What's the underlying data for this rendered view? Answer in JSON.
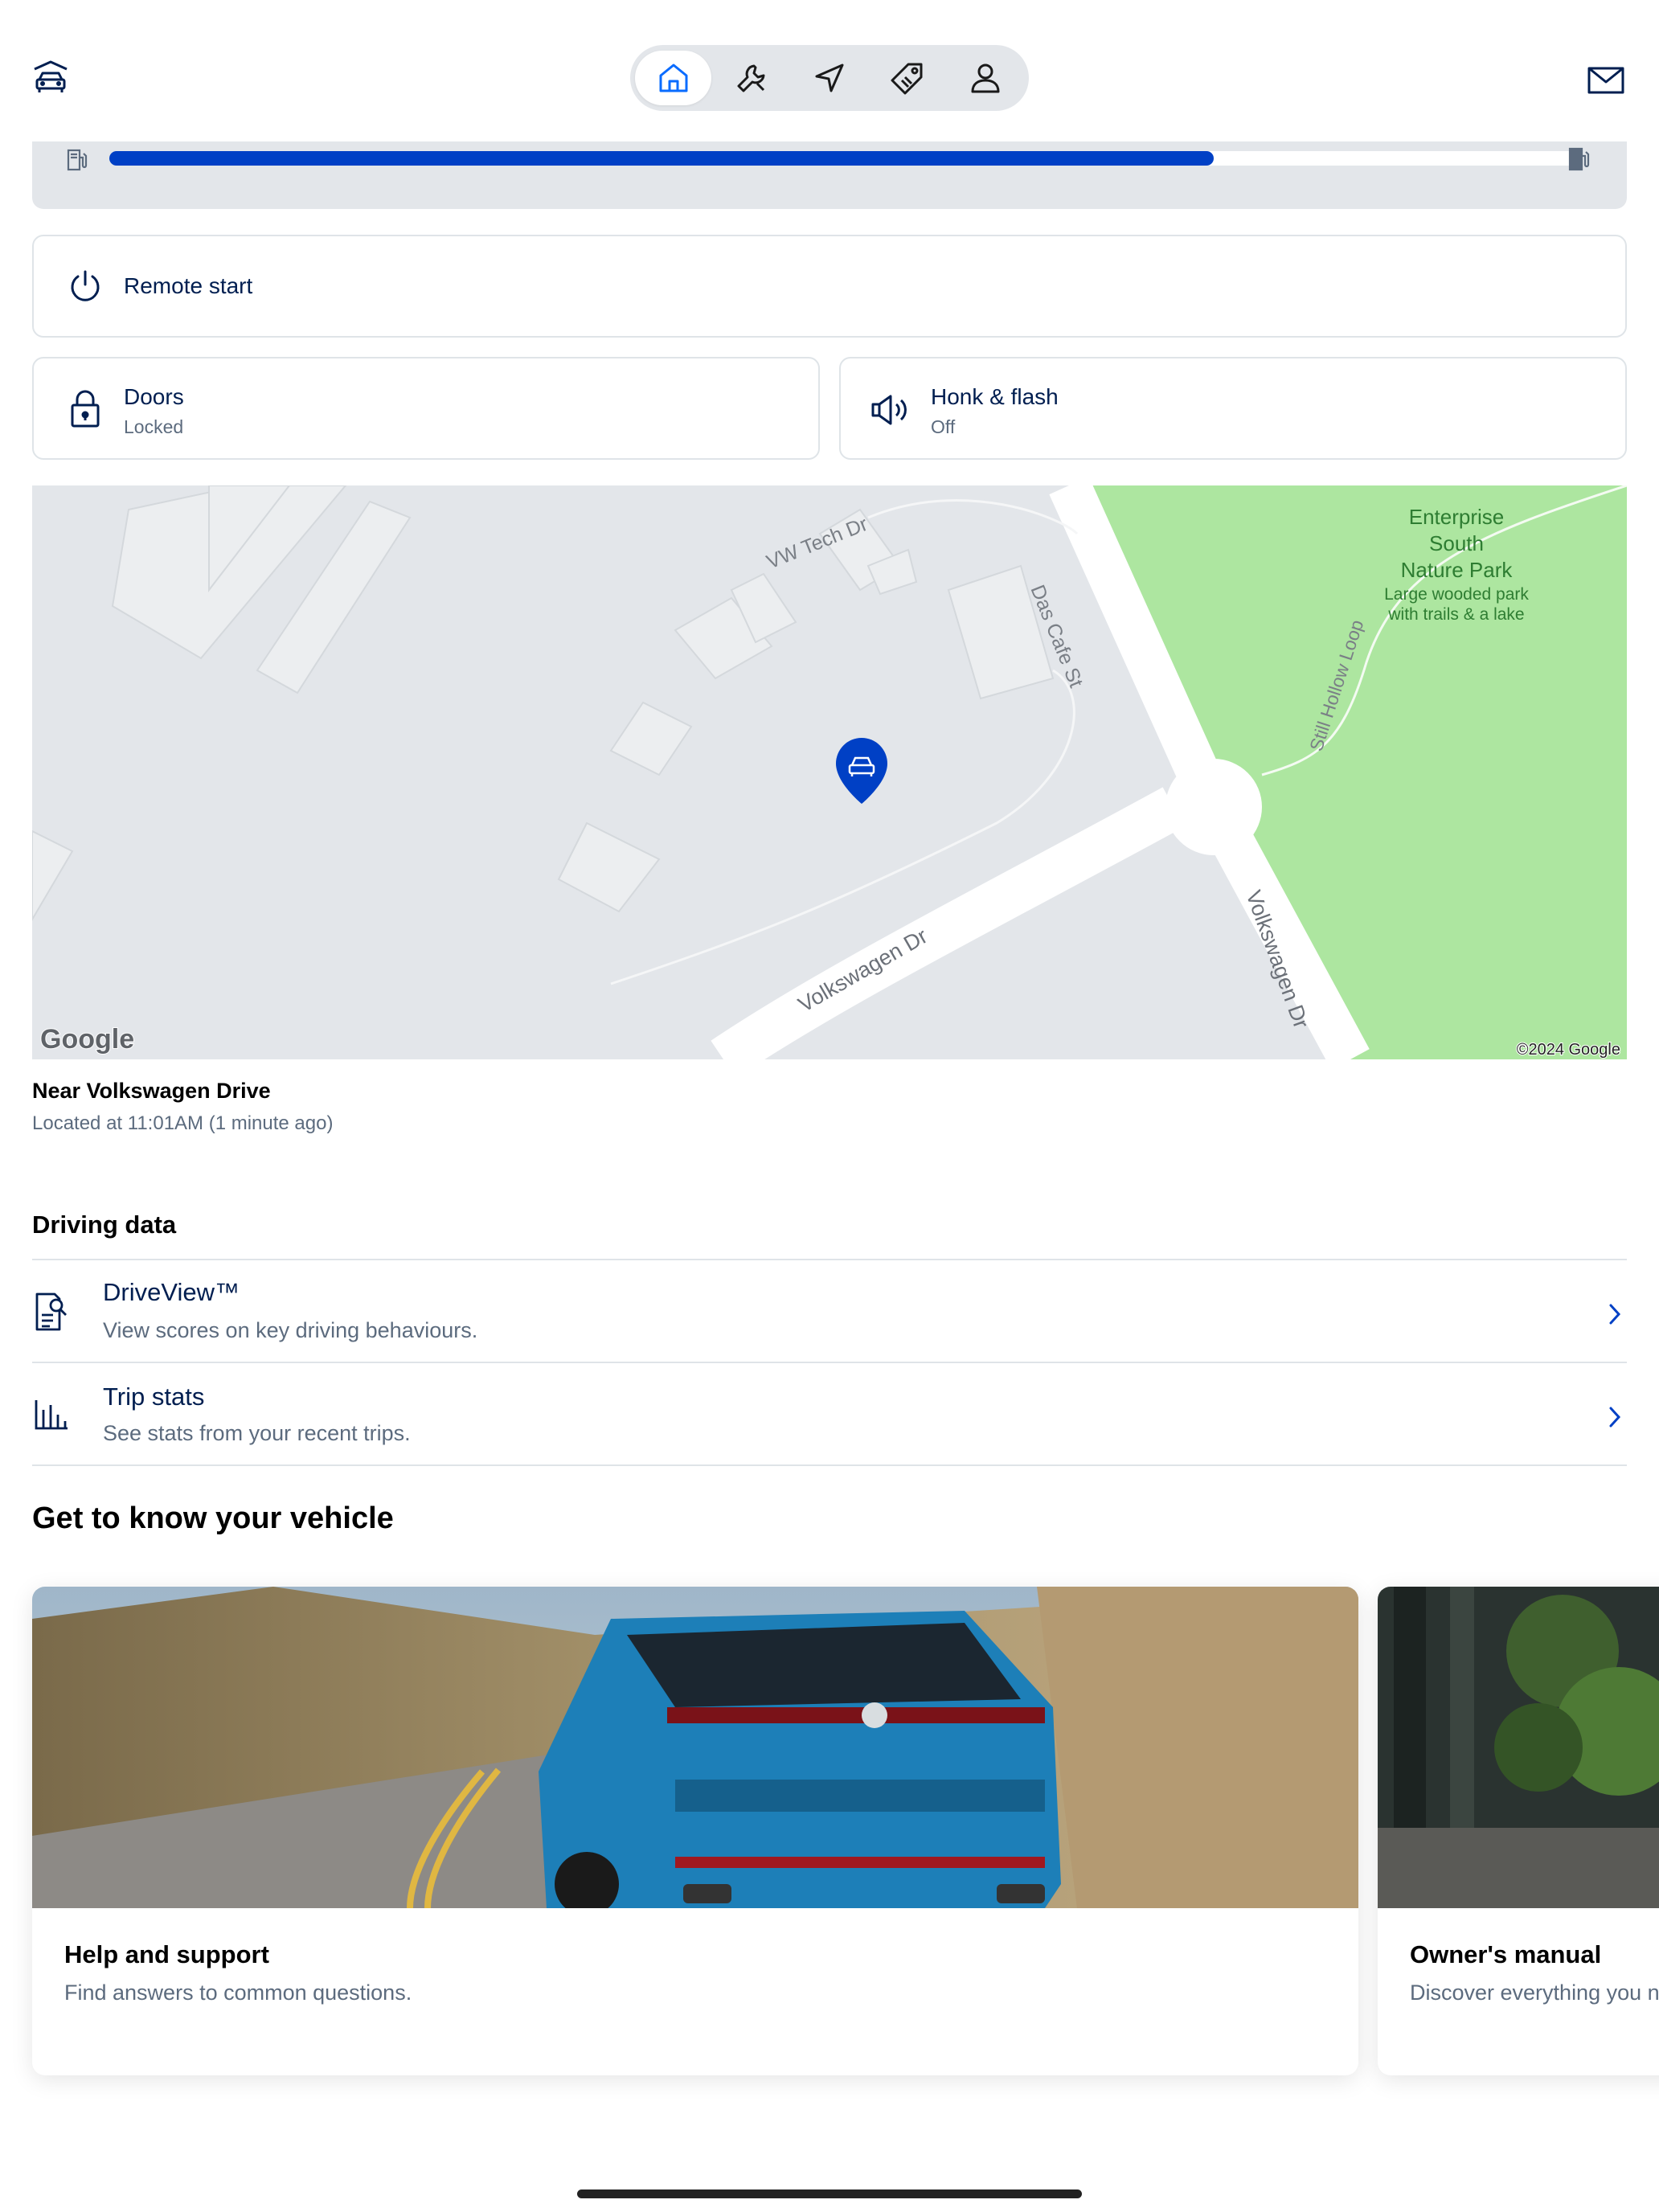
{
  "nav": {
    "items": [
      {
        "icon": "home-icon",
        "active": true
      },
      {
        "icon": "wrench-icon",
        "active": false
      },
      {
        "icon": "navigation-icon",
        "active": false
      },
      {
        "icon": "tag-icon",
        "active": false
      },
      {
        "icon": "profile-icon",
        "active": false
      }
    ],
    "accent": "#0a6cff"
  },
  "fuel": {
    "level_fraction": 0.75,
    "bar_color": "#0040c5"
  },
  "controls": {
    "remote_start": {
      "label": "Remote start"
    },
    "doors": {
      "label": "Doors",
      "status": "Locked"
    },
    "honk": {
      "label": "Honk & flash",
      "status": "Off"
    }
  },
  "map": {
    "streets": [
      "VW Tech Dr",
      "Das Cafe St",
      "Volkswagen Dr",
      "Volkswagen Dr",
      "Still Hollow Loop"
    ],
    "park_name": [
      "Enterprise",
      "South",
      "Nature Park"
    ],
    "park_desc": [
      "Large wooded park",
      "with trails & a lake"
    ],
    "logo": "Google",
    "copyright": "©2024 Google"
  },
  "location": {
    "title": "Near Volkswagen Drive",
    "subtitle": "Located at 11:01AM (1 minute ago)"
  },
  "driving_data": {
    "heading": "Driving data",
    "rows": [
      {
        "title": "DriveView™",
        "subtitle": "View scores on key driving behaviours."
      },
      {
        "title": "Trip stats",
        "subtitle": "See stats from your recent trips."
      }
    ]
  },
  "vehicle": {
    "heading": "Get to know your vehicle",
    "cards": [
      {
        "title": "Help and support",
        "subtitle": "Find answers to common questions."
      },
      {
        "title": "Owner's manual",
        "subtitle": "Discover everything you n"
      }
    ]
  }
}
